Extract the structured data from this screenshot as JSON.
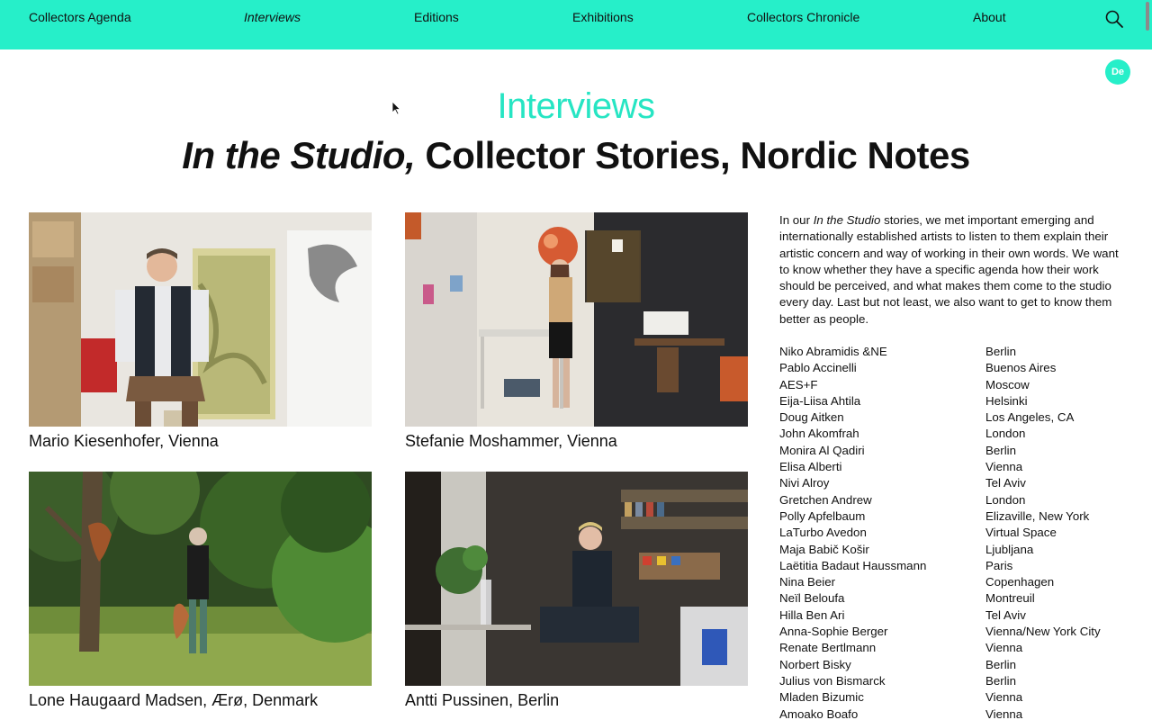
{
  "nav": {
    "items": [
      {
        "label": "Collectors Agenda",
        "active": false
      },
      {
        "label": "Interviews",
        "active": true
      },
      {
        "label": "Editions",
        "active": false
      },
      {
        "label": "Exhibitions",
        "active": false
      },
      {
        "label": "Collectors Chronicle",
        "active": false
      },
      {
        "label": "About",
        "active": false
      }
    ],
    "search_icon": "search-icon",
    "accent_color": "#26efc9"
  },
  "lang_button": "De",
  "page": {
    "title": "Interviews",
    "subtitle_italic": "In the Studio,",
    "subtitle_rest": " Collector Stories, Nordic Notes"
  },
  "cards": [
    {
      "caption": "Mario Kiesenhofer, Vienna"
    },
    {
      "caption": "Stefanie Moshammer, Vienna"
    },
    {
      "caption": "Lone Haugaard Madsen, Ærø, Denmark"
    },
    {
      "caption": "Antti Pussinen, Berlin"
    }
  ],
  "intro": {
    "before": "In our ",
    "italic": "In the Studio",
    "after": " stories, we met important emerging and internationally established artists to listen to them explain their artistic concern and way of working in their own words. We want to know whether they have a specific agenda how their work should be perceived, and what makes them come to the studio every day. Last but not least, we also want to get to know them better as people."
  },
  "artists": [
    {
      "name": "Niko Abramidis &NE",
      "city": "Berlin"
    },
    {
      "name": "Pablo Accinelli",
      "city": "Buenos Aires"
    },
    {
      "name": "AES+F",
      "city": "Moscow"
    },
    {
      "name": "Eija-Liisa Ahtila",
      "city": "Helsinki"
    },
    {
      "name": "Doug Aitken",
      "city": "Los Angeles, CA"
    },
    {
      "name": "John Akomfrah",
      "city": "London"
    },
    {
      "name": "Monira Al Qadiri",
      "city": "Berlin"
    },
    {
      "name": "Elisa Alberti",
      "city": "Vienna"
    },
    {
      "name": "Nivi Alroy",
      "city": "Tel Aviv"
    },
    {
      "name": "Gretchen Andrew",
      "city": "London"
    },
    {
      "name": "Polly Apfelbaum",
      "city": "Elizaville, New York"
    },
    {
      "name": "LaTurbo Avedon",
      "city": "Virtual Space"
    },
    {
      "name": "Maja Babič Košir",
      "city": "Ljubljana"
    },
    {
      "name": "Laëtitia Badaut Haussmann",
      "city": "Paris"
    },
    {
      "name": "Nina Beier",
      "city": "Copenhagen"
    },
    {
      "name": "Neïl Beloufa",
      "city": "Montreuil"
    },
    {
      "name": "Hilla Ben Ari",
      "city": "Tel Aviv"
    },
    {
      "name": "Anna-Sophie Berger",
      "city": "Vienna/New York City"
    },
    {
      "name": "Renate Bertlmann",
      "city": "Vienna"
    },
    {
      "name": "Norbert Bisky",
      "city": "Berlin"
    },
    {
      "name": "Julius von Bismarck",
      "city": "Berlin"
    },
    {
      "name": "Mladen Bizumic",
      "city": "Vienna"
    },
    {
      "name": "Amoako Boafo",
      "city": "Vienna"
    }
  ]
}
